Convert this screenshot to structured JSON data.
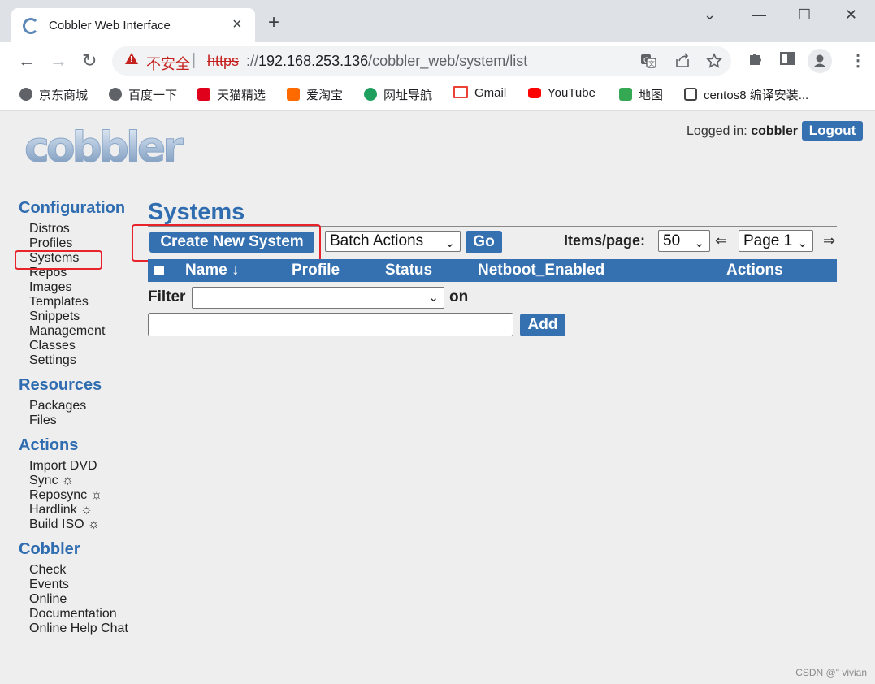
{
  "browser": {
    "tab_title": "Cobbler Web Interface",
    "tab_close": "×",
    "new_tab": "+",
    "window_controls": {
      "minimize": "—",
      "maximize": "☐",
      "close": "✕",
      "dropdown": "⌄"
    },
    "nav": {
      "back": "←",
      "forward": "→",
      "reload": "↻"
    },
    "security_label": "不安全",
    "separator": "|",
    "url_scheme": "https",
    "url_rest_prefix": "://",
    "url_host": "192.168.253.136",
    "url_path": "/cobbler_web/system/list",
    "bookmarks": [
      {
        "label": "京东商城",
        "icon": "globe-icon",
        "color": "#5f6368"
      },
      {
        "label": "百度一下",
        "icon": "globe-icon",
        "color": "#5f6368"
      },
      {
        "label": "天猫精选",
        "icon": "tmall-icon",
        "color": "#e0001b"
      },
      {
        "label": "爱淘宝",
        "icon": "taobao-icon",
        "color": "#ff6a00"
      },
      {
        "label": "网址导航",
        "icon": "nav-site-icon",
        "color": "#1e9f5e"
      },
      {
        "label": "Gmail",
        "icon": "gmail-icon",
        "color": "#ea4335"
      },
      {
        "label": "YouTube",
        "icon": "youtube-icon",
        "color": "#ff0000"
      },
      {
        "label": "地图",
        "icon": "maps-icon",
        "color": "#34a853"
      },
      {
        "label": "centos8 编译安装...",
        "icon": "csdn-icon",
        "color": "#444444"
      }
    ]
  },
  "header": {
    "logged_in_label": "Logged in:",
    "username": "cobbler",
    "logout_label": "Logout",
    "logo_text": "cobbler"
  },
  "sidebar": {
    "sections": [
      {
        "title": "Configuration",
        "items": [
          "Distros",
          "Profiles",
          "Systems",
          "Repos",
          "Images",
          "Templates",
          "Snippets",
          "Management Classes",
          "Settings"
        ]
      },
      {
        "title": "Resources",
        "items": [
          "Packages",
          "Files"
        ]
      },
      {
        "title": "Actions",
        "items": [
          "Import DVD",
          "Sync ☼",
          "Reposync ☼",
          "Hardlink ☼",
          "Build ISO ☼"
        ]
      },
      {
        "title": "Cobbler",
        "items": [
          "Check",
          "Events",
          "Online Documentation",
          "Online Help Chat"
        ]
      }
    ],
    "highlighted": "Systems"
  },
  "main": {
    "title": "Systems",
    "create_button": "Create New System",
    "batch_actions": "Batch Actions",
    "go_button": "Go",
    "items_per_page_label": "Items/page:",
    "items_per_page": "50",
    "prev_arrow": "⇐",
    "page_select": "Page 1",
    "next_arrow": "⇒",
    "table_columns": [
      "Name ↓",
      "Profile",
      "Status",
      "Netboot_Enabled",
      "Actions"
    ],
    "filter_label": "Filter",
    "filter_value": "",
    "on_label": "on",
    "filter_input_value": "",
    "add_button": "Add"
  },
  "watermark": "CSDN @\" vivian",
  "colors": {
    "accent": "#3570b0",
    "highlight_box": "#e8232b",
    "page_bg": "#eeeeee"
  }
}
